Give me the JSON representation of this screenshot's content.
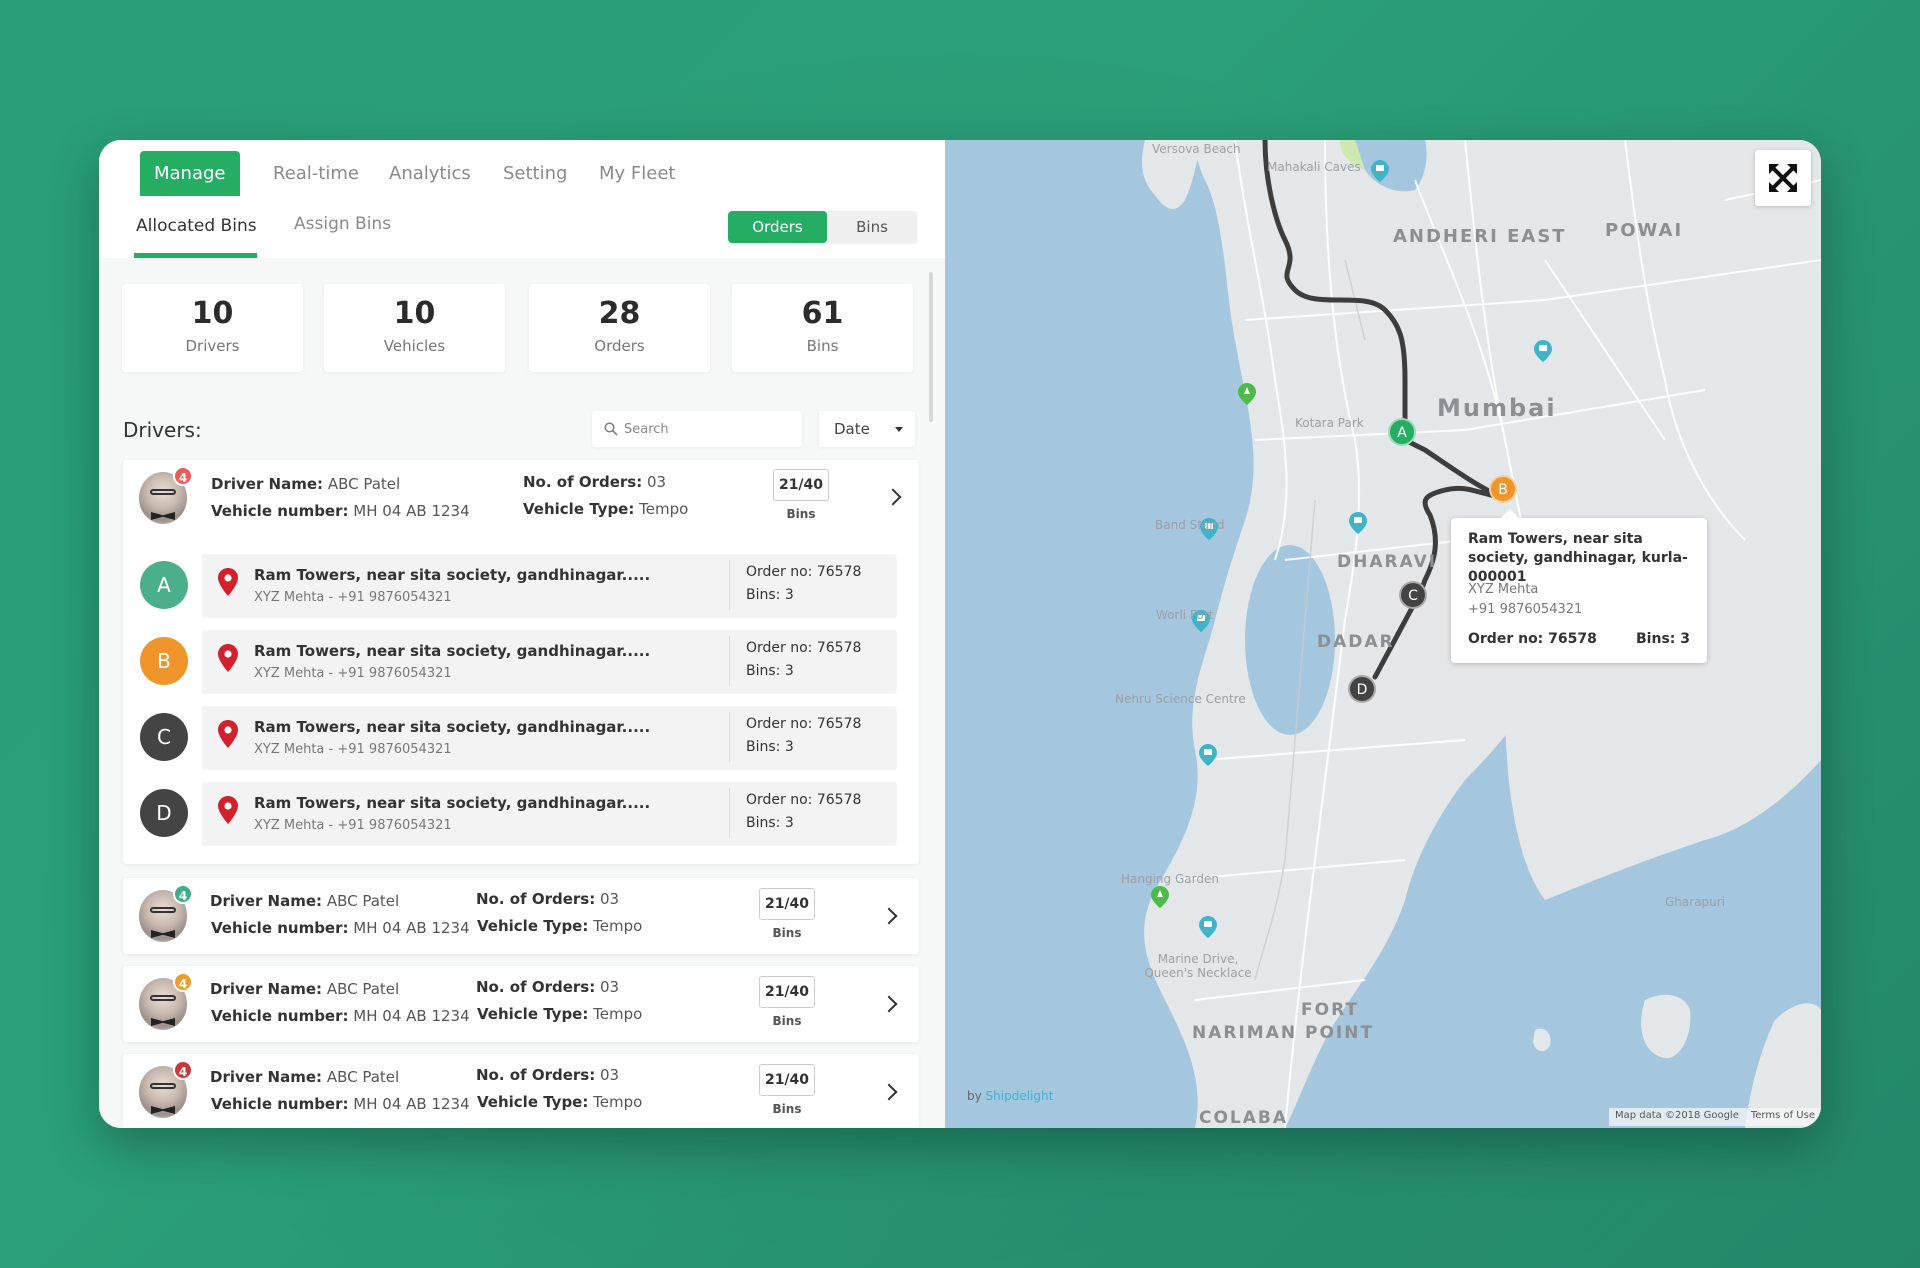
{
  "top_nav": {
    "tabs": [
      {
        "label": "Manage",
        "active": true
      },
      {
        "label": "Real-time",
        "active": false
      },
      {
        "label": "Analytics",
        "active": false
      },
      {
        "label": "Setting",
        "active": false
      },
      {
        "label": "My Fleet",
        "active": false
      }
    ]
  },
  "sub_nav": {
    "tabs": [
      {
        "label": "Allocated Bins",
        "active": true
      },
      {
        "label": "Assign Bins",
        "active": false
      }
    ],
    "toggle": {
      "options": [
        "Orders",
        "Bins"
      ],
      "selected": "Orders"
    }
  },
  "stats": [
    {
      "value": "10",
      "label": "Drivers"
    },
    {
      "value": "10",
      "label": "Vehicles"
    },
    {
      "value": "28",
      "label": "Orders"
    },
    {
      "value": "61",
      "label": "Bins"
    }
  ],
  "drivers_section": {
    "title": "Drivers:",
    "search_placeholder": "Search",
    "sort_select": "Date",
    "labels": {
      "driver_name": "Driver Name:",
      "vehicle_number": "Vehicle number:",
      "orders": "No. of Orders:",
      "vehicle_type": "Vehicle Type:",
      "bins": "Bins"
    },
    "drivers": [
      {
        "badge": "4",
        "badge_color": "#f05a5a",
        "name": "ABC Patel",
        "vehicle_number": "MH 04 AB 1234",
        "orders": "03",
        "vehicle_type": "Tempo",
        "bins": "21/40",
        "expanded": true
      },
      {
        "badge": "4",
        "badge_color": "#3fae8c",
        "name": "ABC Patel",
        "vehicle_number": "MH 04 AB 1234",
        "orders": "03",
        "vehicle_type": "Tempo",
        "bins": "21/40",
        "expanded": false
      },
      {
        "badge": "4",
        "badge_color": "#f09a2a",
        "name": "ABC Patel",
        "vehicle_number": "MH 04 AB 1234",
        "orders": "03",
        "vehicle_type": "Tempo",
        "bins": "21/40",
        "expanded": false
      },
      {
        "badge": "4",
        "badge_color": "#c9373d",
        "name": "ABC Patel",
        "vehicle_number": "MH 04 AB 1234",
        "orders": "03",
        "vehicle_type": "Tempo",
        "bins": "21/40",
        "expanded": false
      }
    ],
    "stops": [
      {
        "letter": "A",
        "color": "#4caf8c",
        "address": "Ram Towers, near sita society, gandhinagar.....",
        "contact": "XYZ Mehta - +91 9876054321",
        "order": "Order no: 76578",
        "bins": "Bins: 3"
      },
      {
        "letter": "B",
        "color": "#f0952a",
        "address": "Ram Towers, near sita society, gandhinagar.....",
        "contact": "XYZ Mehta - +91 9876054321",
        "order": "Order no: 76578",
        "bins": "Bins: 3"
      },
      {
        "letter": "C",
        "color": "#444444",
        "address": "Ram Towers, near sita society, gandhinagar.....",
        "contact": "XYZ Mehta - +91 9876054321",
        "order": "Order no: 76578",
        "bins": "Bins: 3"
      },
      {
        "letter": "D",
        "color": "#444444",
        "address": "Ram Towers, near sita society, gandhinagar.....",
        "contact": "XYZ Mehta - +91 9876054321",
        "order": "Order no: 76578",
        "bins": "Bins: 3"
      }
    ]
  },
  "map": {
    "labels": {
      "andheri": "ANDHERI EAST",
      "powai": "POWAI",
      "mumbai": "Mumbai",
      "dharavi": "DHARAVI",
      "dadar": "DADAR",
      "fort": "FORT",
      "nariman": "NARIMAN POINT",
      "colaba": "COLABA",
      "mahakali": "Mahakali Caves",
      "versova": "Versova Beach",
      "juhu": "Kotara Park",
      "bandstand": "Band Stand",
      "worli": "Worli Fort",
      "nehru": "Nehru Science Centre",
      "hanging": "Hanging Garden",
      "marine": "Marine Drive, Queen's Necklace",
      "gharapuri": "Gharapuri"
    },
    "markers": [
      {
        "letter": "A",
        "color": "#26ad64"
      },
      {
        "letter": "B",
        "color": "#f0952a"
      },
      {
        "letter": "C",
        "color": "#444444"
      },
      {
        "letter": "D",
        "color": "#444444"
      }
    ],
    "popup": {
      "address": "Ram Towers, near sita society, gandhinagar, kurla-000001",
      "name": "XYZ Mehta",
      "phone": "+91 9876054321",
      "order": "Order no: 76578",
      "bins": "Bins: 3"
    },
    "by_prefix": "by",
    "by_brand": "Shipdelight",
    "attribution": "Map data ©2018 Google",
    "terms": "Terms of Use"
  },
  "colors": {
    "accent": "#26ad64",
    "background": "#2a9e78",
    "water": "#a4c6df",
    "land": "#e4e7e9"
  }
}
